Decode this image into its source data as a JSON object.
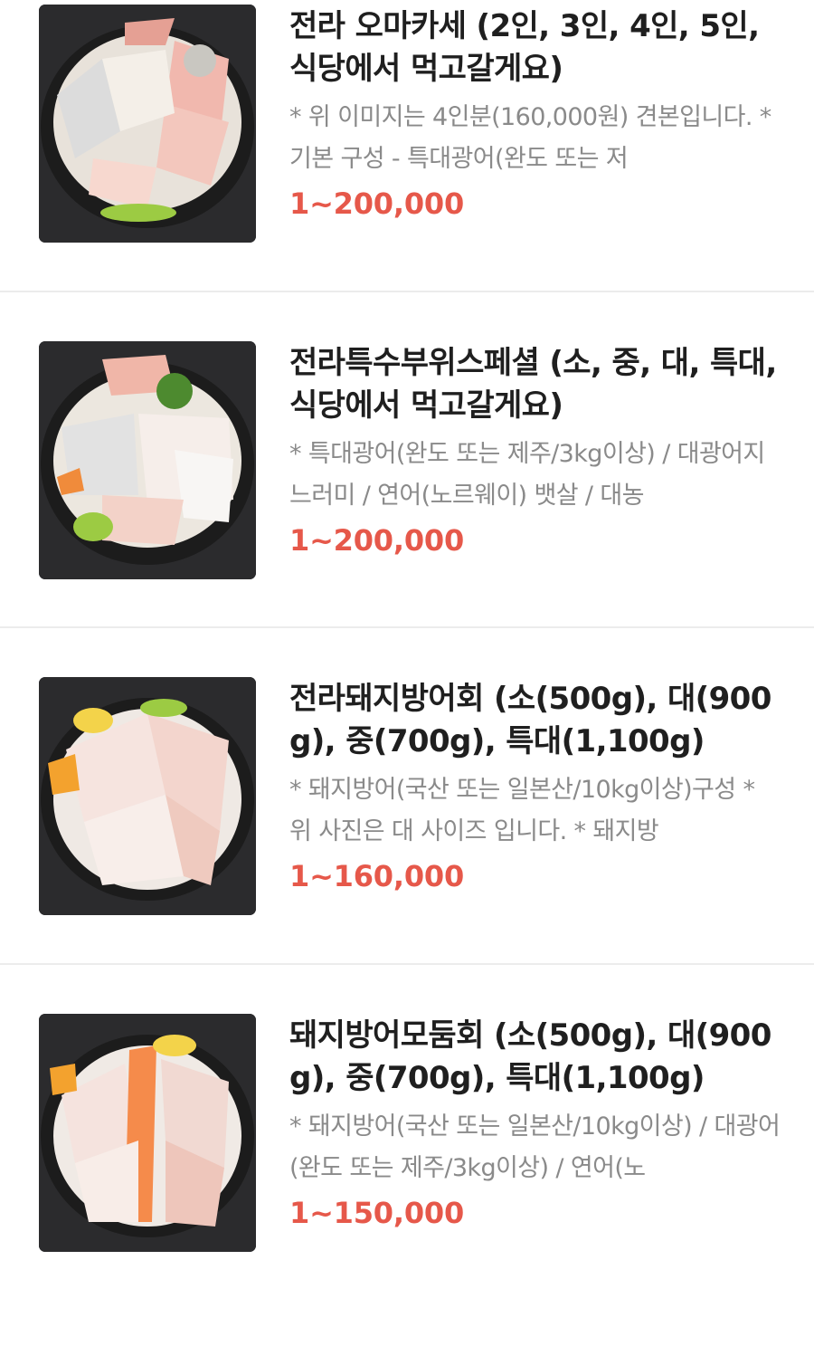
{
  "menu": {
    "items": [
      {
        "name": "전라 오마카세 (2인, 3인, 4인, 5인, 식당에서 먹고갈게요)",
        "description": "* 위 이미지는 4인분(160,000원) 견본입니다.   * 기본 구성 - 특대광어(완도 또는 저",
        "price": "1~200,000",
        "image_icon": "sashimi-platter-image"
      },
      {
        "name": "전라특수부위스페셜 (소, 중, 대, 특대, 식당에서 먹고갈게요)",
        "description": "* 특대광어(완도 또는 제주/3kg이상) / 대광어지느러미 / 연어(노르웨이) 뱃살 / 대농",
        "price": "1~200,000",
        "image_icon": "sashimi-platter-image"
      },
      {
        "name": "전라돼지방어회 (소(500g), 대(900g), 중(700g), 특대(1,100g)",
        "description": "* 돼지방어(국산 또는 일본산/10kg이상)구성  * 위 사진은 대 사이즈 입니다.  * 돼지방",
        "price": "1~160,000",
        "image_icon": "sashimi-platter-image"
      },
      {
        "name": "돼지방어모둠회 (소(500g), 대(900g), 중(700g), 특대(1,100g)",
        "description": "* 돼지방어(국산 또는 일본산/10kg이상) / 대광어(완도 또는 제주/3kg이상) / 연어(노",
        "price": "1~150,000",
        "image_icon": "sashimi-platter-image"
      }
    ]
  },
  "colors": {
    "price": "#e6584a",
    "title": "#1f1f1f",
    "description": "#8a8a8a",
    "divider": "#ececec",
    "image_background": "#2b2b2d"
  }
}
